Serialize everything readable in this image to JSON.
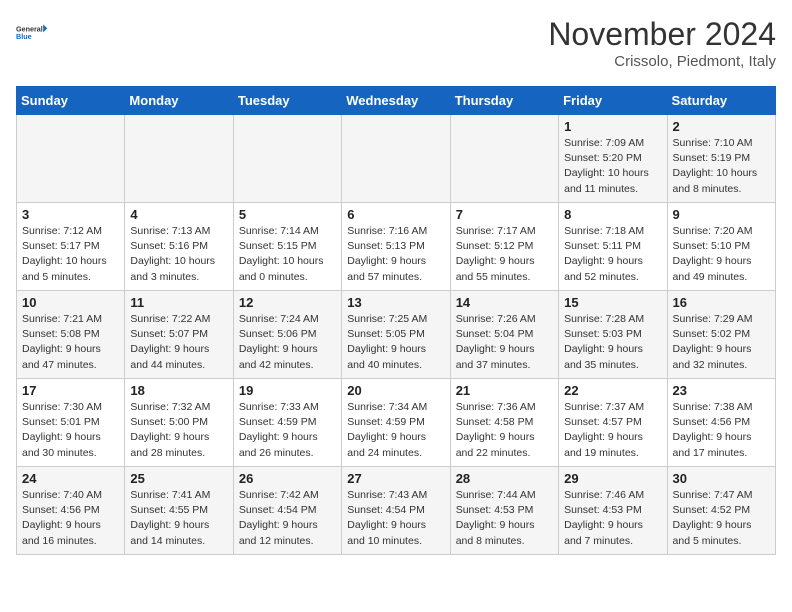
{
  "logo": {
    "line1": "General",
    "line2": "Blue"
  },
  "title": "November 2024",
  "subtitle": "Crissolo, Piedmont, Italy",
  "weekdays": [
    "Sunday",
    "Monday",
    "Tuesday",
    "Wednesday",
    "Thursday",
    "Friday",
    "Saturday"
  ],
  "weeks": [
    [
      {
        "day": "",
        "info": ""
      },
      {
        "day": "",
        "info": ""
      },
      {
        "day": "",
        "info": ""
      },
      {
        "day": "",
        "info": ""
      },
      {
        "day": "",
        "info": ""
      },
      {
        "day": "1",
        "info": "Sunrise: 7:09 AM\nSunset: 5:20 PM\nDaylight: 10 hours\nand 11 minutes."
      },
      {
        "day": "2",
        "info": "Sunrise: 7:10 AM\nSunset: 5:19 PM\nDaylight: 10 hours\nand 8 minutes."
      }
    ],
    [
      {
        "day": "3",
        "info": "Sunrise: 7:12 AM\nSunset: 5:17 PM\nDaylight: 10 hours\nand 5 minutes."
      },
      {
        "day": "4",
        "info": "Sunrise: 7:13 AM\nSunset: 5:16 PM\nDaylight: 10 hours\nand 3 minutes."
      },
      {
        "day": "5",
        "info": "Sunrise: 7:14 AM\nSunset: 5:15 PM\nDaylight: 10 hours\nand 0 minutes."
      },
      {
        "day": "6",
        "info": "Sunrise: 7:16 AM\nSunset: 5:13 PM\nDaylight: 9 hours\nand 57 minutes."
      },
      {
        "day": "7",
        "info": "Sunrise: 7:17 AM\nSunset: 5:12 PM\nDaylight: 9 hours\nand 55 minutes."
      },
      {
        "day": "8",
        "info": "Sunrise: 7:18 AM\nSunset: 5:11 PM\nDaylight: 9 hours\nand 52 minutes."
      },
      {
        "day": "9",
        "info": "Sunrise: 7:20 AM\nSunset: 5:10 PM\nDaylight: 9 hours\nand 49 minutes."
      }
    ],
    [
      {
        "day": "10",
        "info": "Sunrise: 7:21 AM\nSunset: 5:08 PM\nDaylight: 9 hours\nand 47 minutes."
      },
      {
        "day": "11",
        "info": "Sunrise: 7:22 AM\nSunset: 5:07 PM\nDaylight: 9 hours\nand 44 minutes."
      },
      {
        "day": "12",
        "info": "Sunrise: 7:24 AM\nSunset: 5:06 PM\nDaylight: 9 hours\nand 42 minutes."
      },
      {
        "day": "13",
        "info": "Sunrise: 7:25 AM\nSunset: 5:05 PM\nDaylight: 9 hours\nand 40 minutes."
      },
      {
        "day": "14",
        "info": "Sunrise: 7:26 AM\nSunset: 5:04 PM\nDaylight: 9 hours\nand 37 minutes."
      },
      {
        "day": "15",
        "info": "Sunrise: 7:28 AM\nSunset: 5:03 PM\nDaylight: 9 hours\nand 35 minutes."
      },
      {
        "day": "16",
        "info": "Sunrise: 7:29 AM\nSunset: 5:02 PM\nDaylight: 9 hours\nand 32 minutes."
      }
    ],
    [
      {
        "day": "17",
        "info": "Sunrise: 7:30 AM\nSunset: 5:01 PM\nDaylight: 9 hours\nand 30 minutes."
      },
      {
        "day": "18",
        "info": "Sunrise: 7:32 AM\nSunset: 5:00 PM\nDaylight: 9 hours\nand 28 minutes."
      },
      {
        "day": "19",
        "info": "Sunrise: 7:33 AM\nSunset: 4:59 PM\nDaylight: 9 hours\nand 26 minutes."
      },
      {
        "day": "20",
        "info": "Sunrise: 7:34 AM\nSunset: 4:59 PM\nDaylight: 9 hours\nand 24 minutes."
      },
      {
        "day": "21",
        "info": "Sunrise: 7:36 AM\nSunset: 4:58 PM\nDaylight: 9 hours\nand 22 minutes."
      },
      {
        "day": "22",
        "info": "Sunrise: 7:37 AM\nSunset: 4:57 PM\nDaylight: 9 hours\nand 19 minutes."
      },
      {
        "day": "23",
        "info": "Sunrise: 7:38 AM\nSunset: 4:56 PM\nDaylight: 9 hours\nand 17 minutes."
      }
    ],
    [
      {
        "day": "24",
        "info": "Sunrise: 7:40 AM\nSunset: 4:56 PM\nDaylight: 9 hours\nand 16 minutes."
      },
      {
        "day": "25",
        "info": "Sunrise: 7:41 AM\nSunset: 4:55 PM\nDaylight: 9 hours\nand 14 minutes."
      },
      {
        "day": "26",
        "info": "Sunrise: 7:42 AM\nSunset: 4:54 PM\nDaylight: 9 hours\nand 12 minutes."
      },
      {
        "day": "27",
        "info": "Sunrise: 7:43 AM\nSunset: 4:54 PM\nDaylight: 9 hours\nand 10 minutes."
      },
      {
        "day": "28",
        "info": "Sunrise: 7:44 AM\nSunset: 4:53 PM\nDaylight: 9 hours\nand 8 minutes."
      },
      {
        "day": "29",
        "info": "Sunrise: 7:46 AM\nSunset: 4:53 PM\nDaylight: 9 hours\nand 7 minutes."
      },
      {
        "day": "30",
        "info": "Sunrise: 7:47 AM\nSunset: 4:52 PM\nDaylight: 9 hours\nand 5 minutes."
      }
    ]
  ]
}
